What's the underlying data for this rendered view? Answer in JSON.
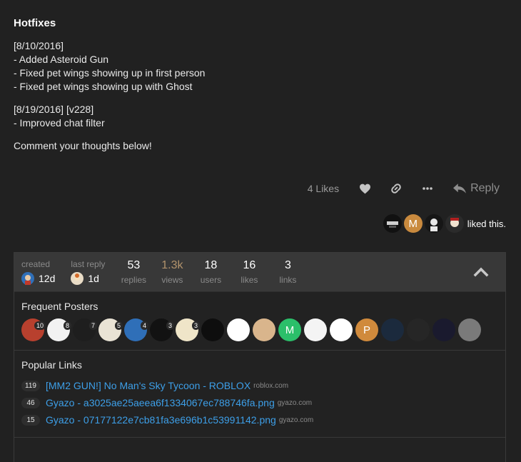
{
  "post": {
    "heading": "Hotfixes",
    "paragraphs": [
      [
        "[8/10/2016]",
        "- Added Asteroid Gun",
        "- Fixed pet wings showing up in first person",
        "- Fixed pet wings showing up with Ghost"
      ],
      [
        "[8/19/2016] [v228]",
        "- Improved chat filter"
      ],
      [
        "Comment your thoughts below!"
      ]
    ]
  },
  "actions": {
    "likes_label": "4 Likes",
    "reply_label": "Reply",
    "icons": [
      "heart-icon",
      "link-icon",
      "more-icon",
      "reply-icon"
    ]
  },
  "liked_by": {
    "text": "liked this.",
    "avatars": [
      {
        "color": "#111111",
        "letter": ""
      },
      {
        "color": "#c98a3e",
        "letter": "M"
      },
      {
        "color": "#161616",
        "letter": ""
      },
      {
        "color": "#2b2b2b",
        "letter": ""
      }
    ]
  },
  "topic_map": {
    "created_label": "created",
    "created_value": "12d",
    "last_reply_label": "last reply",
    "last_reply_value": "1d",
    "stats": [
      {
        "value": "53",
        "label": "replies"
      },
      {
        "value": "1.3k",
        "label": "views"
      },
      {
        "value": "18",
        "label": "users"
      },
      {
        "value": "16",
        "label": "likes"
      },
      {
        "value": "3",
        "label": "links"
      }
    ],
    "frequent_posters_title": "Frequent Posters",
    "posters": [
      {
        "color": "#b8402e",
        "count": "10",
        "letter": ""
      },
      {
        "color": "#f2f2f2",
        "count": "8",
        "letter": ""
      },
      {
        "color": "#1e1e1e",
        "count": "7",
        "letter": ""
      },
      {
        "color": "#e9e3d5",
        "count": "5",
        "letter": ""
      },
      {
        "color": "#2f6fb8",
        "count": "4",
        "letter": ""
      },
      {
        "color": "#121212",
        "count": "3",
        "letter": ""
      },
      {
        "color": "#efe5c8",
        "count": "3",
        "letter": ""
      },
      {
        "color": "#0e0e0e",
        "count": "",
        "letter": ""
      },
      {
        "color": "#ffffff",
        "count": "",
        "letter": ""
      },
      {
        "color": "#d9b58c",
        "count": "",
        "letter": ""
      },
      {
        "color": "#2bbf6a",
        "count": "",
        "letter": "M"
      },
      {
        "color": "#f4f4f4",
        "count": "",
        "letter": ""
      },
      {
        "color": "#ffffff",
        "count": "",
        "letter": ""
      },
      {
        "color": "#d08a3c",
        "count": "",
        "letter": "P"
      },
      {
        "color": "#1b2a3d",
        "count": "",
        "letter": ""
      },
      {
        "color": "#262626",
        "count": "",
        "letter": ""
      },
      {
        "color": "#1a1a2e",
        "count": "",
        "letter": ""
      },
      {
        "color": "#7a7a7a",
        "count": "",
        "letter": ""
      }
    ],
    "popular_links_title": "Popular Links",
    "links": [
      {
        "clicks": "119",
        "title": "[MM2 GUN!] No Man's Sky Tycoon - ROBLOX",
        "domain": "roblox.com"
      },
      {
        "clicks": "46",
        "title": "Gyazo - a3025ae25aeea6f1334067ec788746fa.png",
        "domain": "gyazo.com"
      },
      {
        "clicks": "15",
        "title": "Gyazo - 07177122e7cb81fa3e696b1c53991142.png",
        "domain": "gyazo.com"
      }
    ]
  },
  "colors": {
    "background": "#212121",
    "link": "#3d9fe8",
    "views_accent": "#b2936c",
    "map_header": "#383838"
  }
}
